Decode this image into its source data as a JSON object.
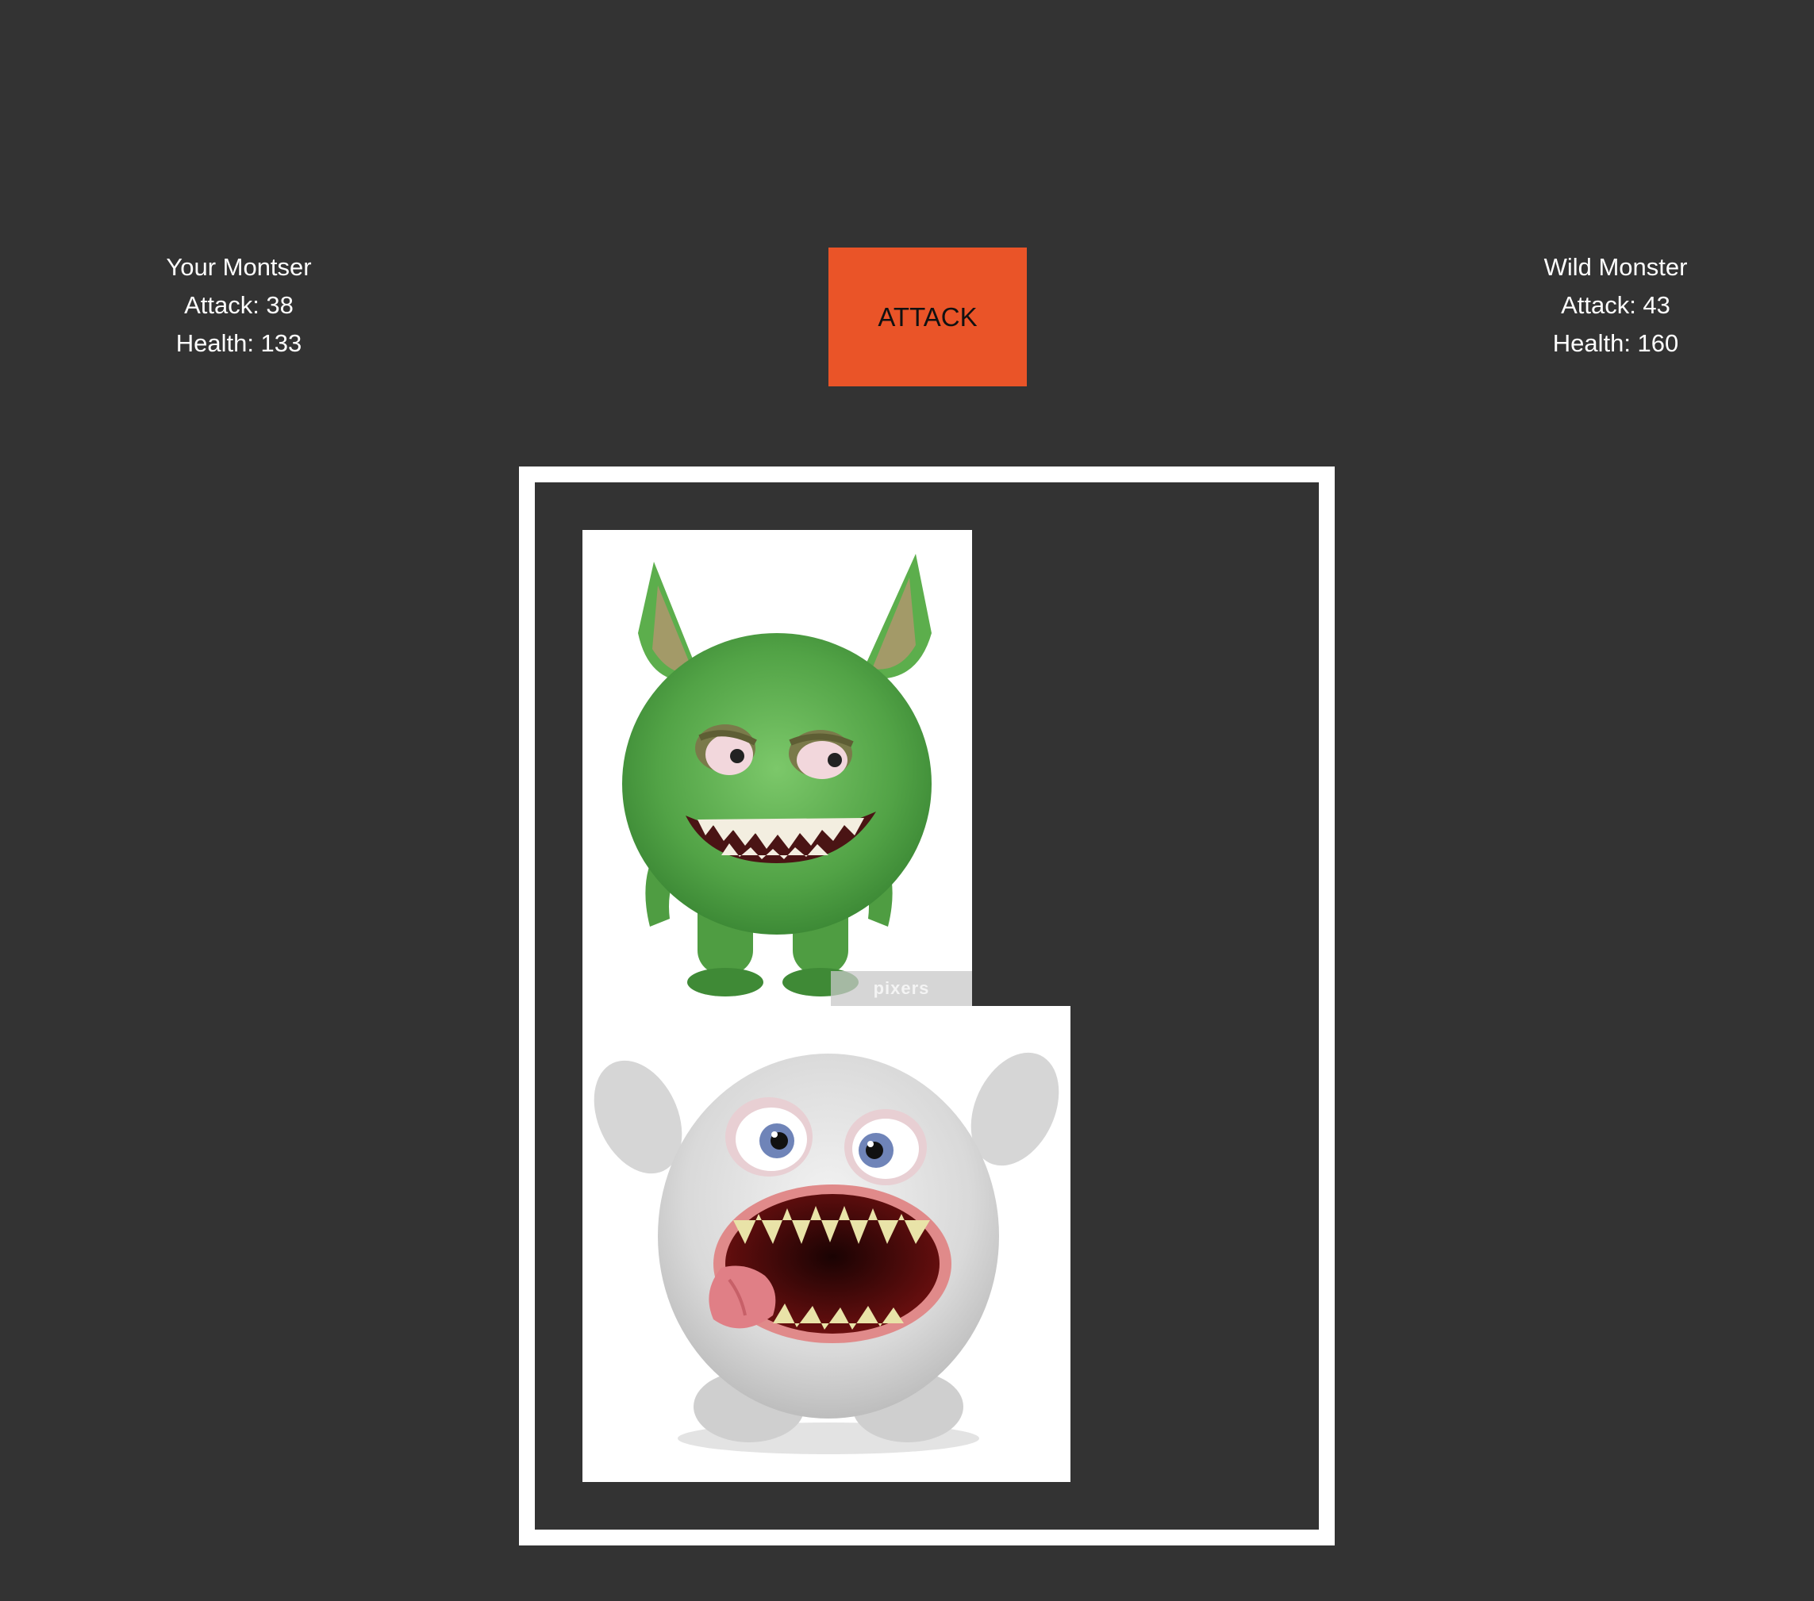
{
  "player": {
    "title": "Your Montser",
    "attack": "Attack: 38",
    "health": "Health: 133"
  },
  "wild": {
    "title": "Wild Monster",
    "attack": "Attack: 43",
    "health": "Health: 160"
  },
  "controls": {
    "attack_label": "ATTACK"
  },
  "images": {
    "player_watermark": "pixers"
  },
  "colors": {
    "background": "#333333",
    "attack_button": "#ea5428",
    "text": "#ffffff",
    "arena_border": "#ffffff"
  }
}
